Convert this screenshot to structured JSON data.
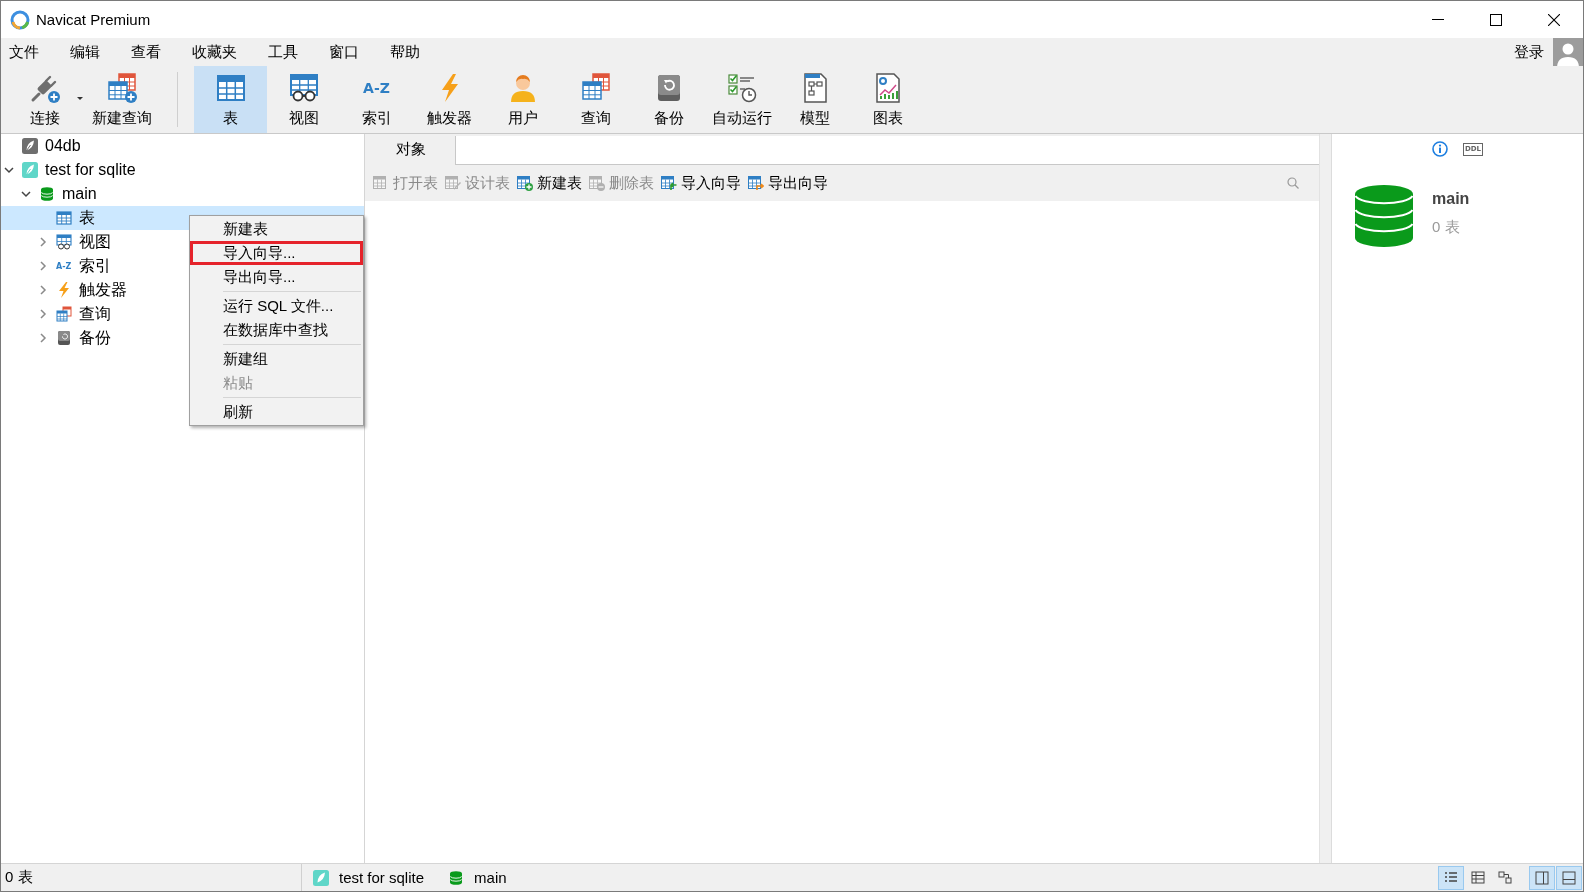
{
  "window": {
    "title": "Navicat Premium"
  },
  "menu_bar": {
    "items": [
      "文件",
      "编辑",
      "查看",
      "收藏夹",
      "工具",
      "窗口",
      "帮助"
    ],
    "login": "登录"
  },
  "toolbar": {
    "groups": [
      [
        {
          "kind": "connect",
          "label": "连接",
          "selected": false,
          "dropdown": true
        },
        {
          "kind": "new_query",
          "label": "新建查询",
          "selected": false,
          "dropdown": false
        }
      ],
      [
        {
          "kind": "table",
          "label": "表",
          "selected": true,
          "dropdown": false
        },
        {
          "kind": "view",
          "label": "视图",
          "selected": false,
          "dropdown": false
        },
        {
          "kind": "index",
          "label": "索引",
          "icon_text": "A-Z",
          "selected": false,
          "dropdown": false
        },
        {
          "kind": "trigger",
          "label": "触发器",
          "selected": false,
          "dropdown": false
        },
        {
          "kind": "user",
          "label": "用户",
          "selected": false,
          "dropdown": false
        },
        {
          "kind": "query",
          "label": "查询",
          "selected": false,
          "dropdown": false
        },
        {
          "kind": "backup",
          "label": "备份",
          "selected": false,
          "dropdown": false
        },
        {
          "kind": "auto_run",
          "label": "自动运行",
          "selected": false,
          "dropdown": false
        },
        {
          "kind": "model",
          "label": "模型",
          "selected": false,
          "dropdown": false
        },
        {
          "kind": "chart",
          "label": "图表",
          "selected": false,
          "dropdown": false
        }
      ]
    ]
  },
  "tree": [
    {
      "kind": "connection",
      "label": "04db",
      "open": false,
      "selected": false
    },
    {
      "kind": "connection",
      "label": "test for sqlite",
      "open": true,
      "expanded": true,
      "selected": false,
      "children": [
        {
          "kind": "database",
          "label": "main",
          "expanded": true,
          "selected": false,
          "children": [
            {
              "kind": "tables",
              "label": "表",
              "selected": true
            },
            {
              "kind": "views",
              "label": "视图",
              "expanded": false,
              "selected": false
            },
            {
              "kind": "indexes",
              "label": "索引",
              "icon_text": "A-Z",
              "expanded": false,
              "selected": false
            },
            {
              "kind": "triggers",
              "label": "触发器",
              "expanded": false,
              "selected": false
            },
            {
              "kind": "queries",
              "label": "查询",
              "expanded": false,
              "selected": false
            },
            {
              "kind": "backups",
              "label": "备份",
              "expanded": false,
              "selected": false
            }
          ]
        }
      ]
    }
  ],
  "context_menu": {
    "groups": [
      [
        {
          "label": "新建表",
          "disabled": false,
          "highlighted": false
        },
        {
          "label": "导入向导...",
          "disabled": false,
          "highlighted": true
        },
        {
          "label": "导出向导...",
          "disabled": false,
          "highlighted": false
        }
      ],
      [
        {
          "label": "运行 SQL 文件...",
          "disabled": false,
          "highlighted": false
        },
        {
          "label": "在数据库中查找",
          "disabled": false,
          "highlighted": false
        }
      ],
      [
        {
          "label": "新建组",
          "disabled": false,
          "highlighted": false
        },
        {
          "label": "粘贴",
          "disabled": true,
          "highlighted": false
        }
      ],
      [
        {
          "label": "刷新",
          "disabled": false,
          "highlighted": false
        }
      ]
    ]
  },
  "object_pane": {
    "tabs": [
      {
        "label": "对象",
        "selected": true
      }
    ],
    "toolbar": [
      {
        "kind": "open_table",
        "label": "打开表",
        "disabled": true
      },
      {
        "kind": "design_table",
        "label": "设计表",
        "disabled": true
      },
      {
        "kind": "new_table",
        "label": "新建表",
        "disabled": false
      },
      {
        "kind": "delete_table",
        "label": "删除表",
        "disabled": true
      },
      {
        "kind": "import",
        "label": "导入向导",
        "disabled": false
      },
      {
        "kind": "export",
        "label": "导出向导",
        "disabled": false
      }
    ]
  },
  "info_panel": {
    "tabs": [
      {
        "kind": "info",
        "selected": true
      },
      {
        "kind": "ddl",
        "label": "DDL",
        "selected": false
      }
    ],
    "name": "main",
    "count": "0 表"
  },
  "status_bar": {
    "text": "0 表",
    "connection": "test for sqlite",
    "database": "main",
    "view_buttons": [
      {
        "kind": "list",
        "selected": true
      },
      {
        "kind": "detail",
        "selected": false
      },
      {
        "kind": "er",
        "selected": false
      }
    ],
    "panel_buttons": [
      {
        "kind": "side_panel",
        "on": true
      },
      {
        "kind": "bottom_panel",
        "on": true
      }
    ]
  }
}
